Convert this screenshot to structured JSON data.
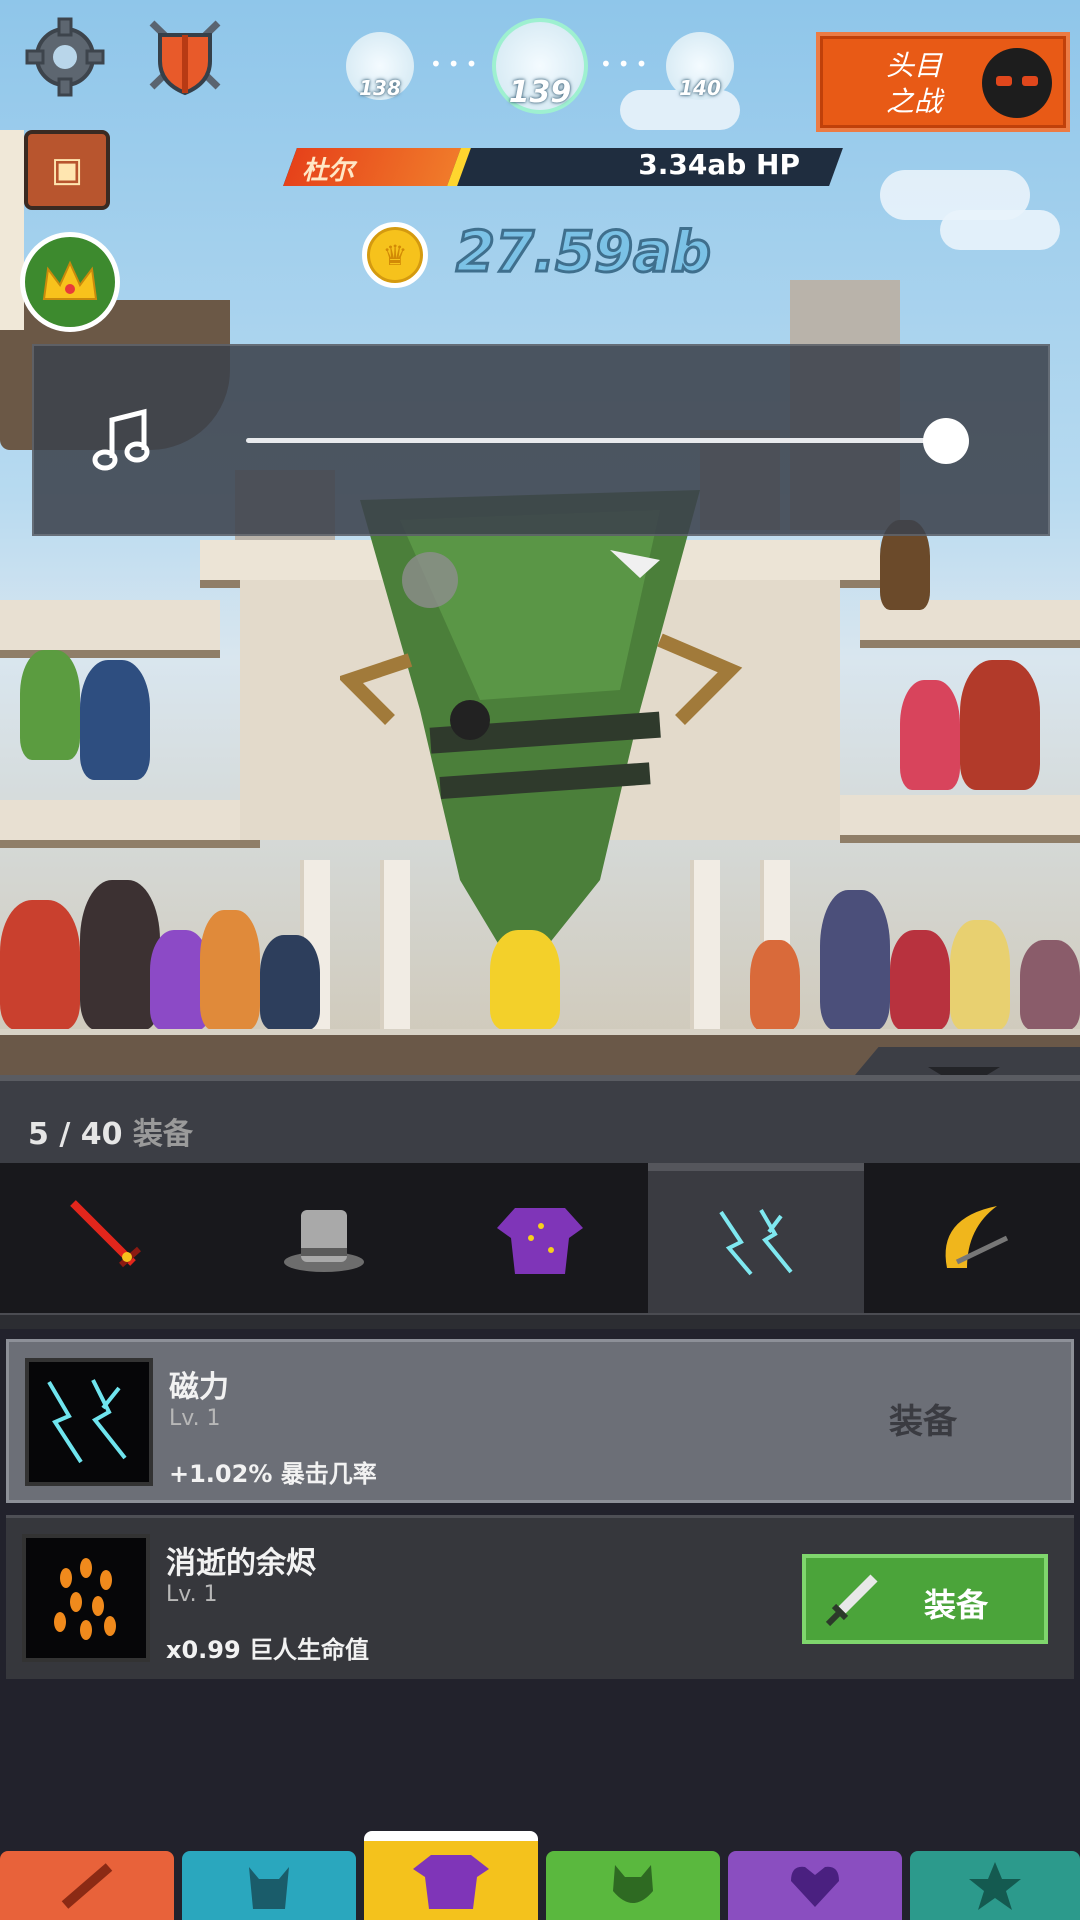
{
  "top": {
    "settings_icon": "gear-icon",
    "shield_icon": "crossed-swords-shield-icon",
    "shop_icon": "treasure-chest-icon",
    "crown_icon": "crown-icon"
  },
  "stages": {
    "prev": "138",
    "current": "139",
    "next": "140"
  },
  "boss_button": {
    "label_line1": "头目",
    "label_line2": "之战"
  },
  "enemy": {
    "name": "杜尔",
    "hp": "3.34ab HP",
    "hp_fraction": 0.3
  },
  "gold": {
    "amount": "27.59ab"
  },
  "volume": {
    "icon": "music-note-icon",
    "level_fraction": 1.0
  },
  "equipment": {
    "count": "5 / 40",
    "count_label": "装备",
    "tabs": [
      {
        "icon": "sword-icon"
      },
      {
        "icon": "top-hat-icon"
      },
      {
        "icon": "robe-icon"
      },
      {
        "icon": "lightning-aura-icon"
      },
      {
        "icon": "golden-slash-icon"
      }
    ],
    "items": [
      {
        "name": "磁力",
        "level": "Lv. 1",
        "effect": "+1.02% 暴击几率",
        "action": "装备"
      },
      {
        "name": "消逝的余烬",
        "level": "Lv. 1",
        "effect": "x0.99 巨人生命值",
        "action": "装备"
      }
    ]
  },
  "bottom_nav": [
    {
      "icon": "sword-nav-icon",
      "color": "#e8623a"
    },
    {
      "icon": "heroes-nav-icon",
      "color": "#2aa7be"
    },
    {
      "icon": "equipment-nav-icon",
      "color": "#f4c21c"
    },
    {
      "icon": "pets-nav-icon",
      "color": "#5ab83e"
    },
    {
      "icon": "artifacts-nav-icon",
      "color": "#8a4ec0"
    },
    {
      "icon": "shop-nav-icon",
      "color": "#2c9a8c"
    }
  ]
}
